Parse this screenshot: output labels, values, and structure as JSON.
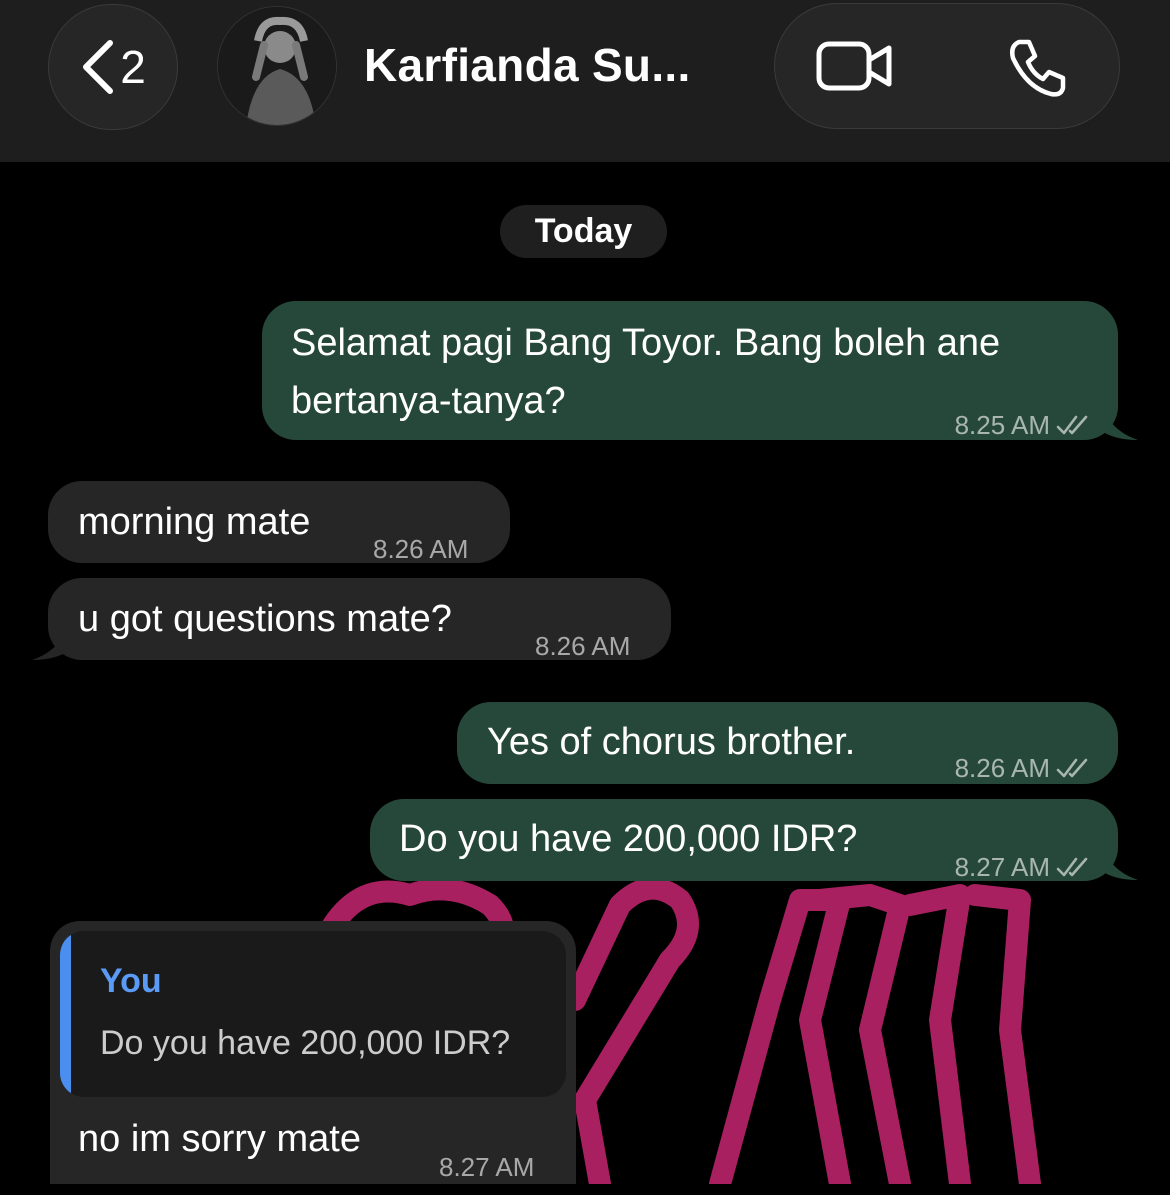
{
  "header": {
    "back_count": "2",
    "contact_name": "Karfianda Su...",
    "icons": {
      "back": "chevron-left-icon",
      "video": "video-camera-icon",
      "phone": "phone-icon"
    }
  },
  "date_separator": "Today",
  "messages": [
    {
      "direction": "outgoing",
      "lines": [
        "Selamat pagi Bang Toyor. Bang boleh ane",
        "bertanya-tanya?"
      ],
      "time": "8.25 AM",
      "status": "read"
    },
    {
      "direction": "incoming",
      "text": "morning mate",
      "time": "8.26 AM"
    },
    {
      "direction": "incoming",
      "text": "u got questions mate?",
      "time": "8.26 AM"
    },
    {
      "direction": "outgoing",
      "text": "Yes of chorus brother.",
      "time": "8.26 AM",
      "status": "read"
    },
    {
      "direction": "outgoing",
      "text": "Do you have 200,000 IDR?",
      "time": "8.27 AM",
      "status": "read"
    },
    {
      "direction": "incoming",
      "reply_to": {
        "author": "You",
        "text": "Do you have 200,000 IDR?"
      },
      "text": "no im sorry mate",
      "time": "8.27 AM"
    }
  ],
  "colors": {
    "outgoing_bubble": "#26483a",
    "incoming_bubble": "#262626",
    "header": "#1e1e1e",
    "reply_accent": "#4a8ff0",
    "wallpaper_doodle": "#a8205f"
  }
}
